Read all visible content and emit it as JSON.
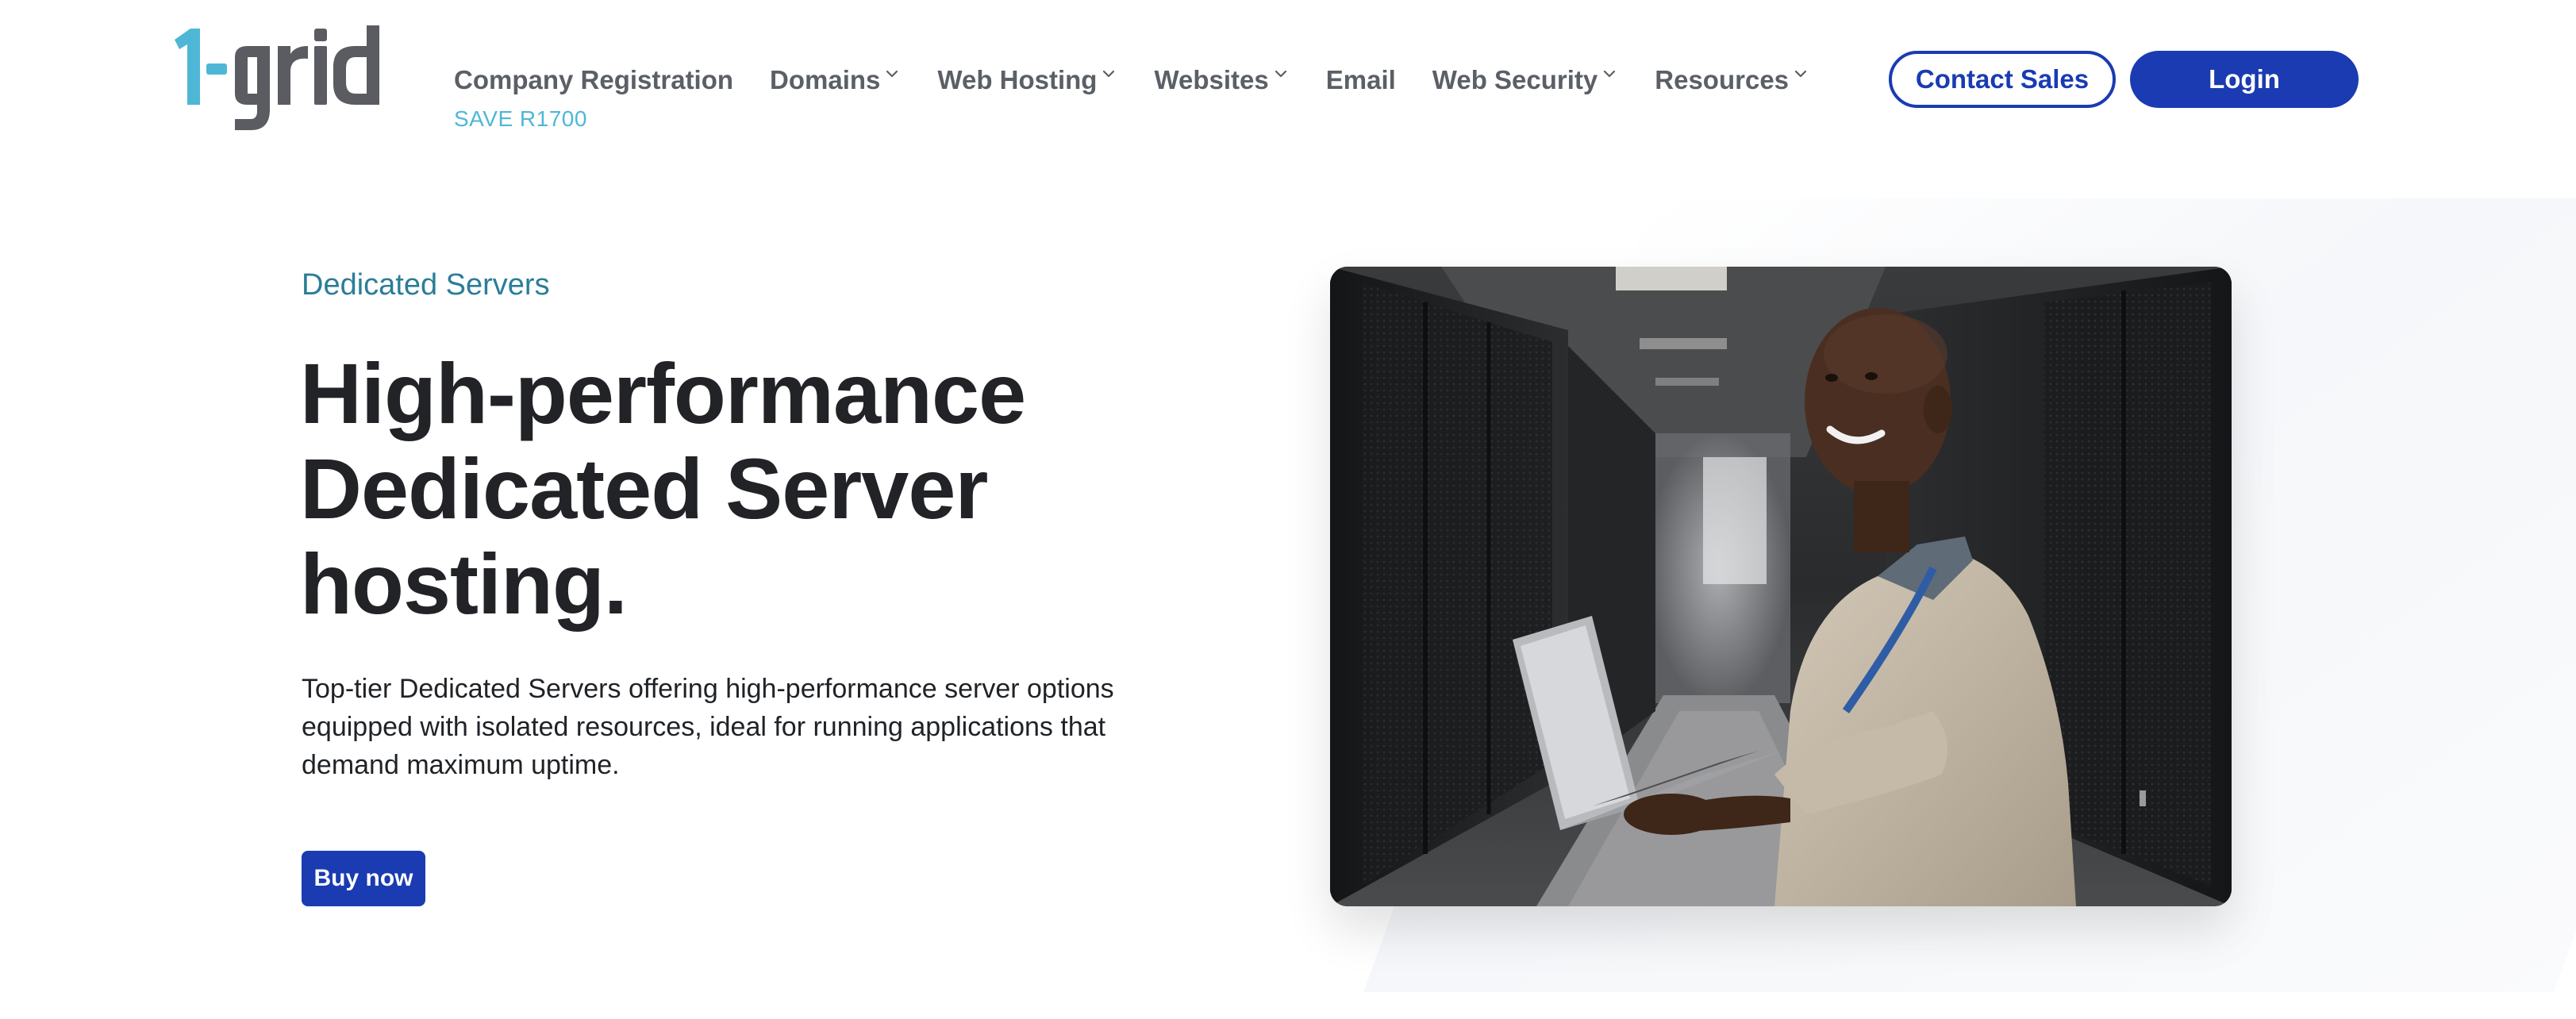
{
  "brand": {
    "logo_text": "1-grid",
    "colors": {
      "logo_accent": "#4fb7d6",
      "logo_dark": "#5a5c61",
      "primary": "#1a3bb2",
      "eyebrow": "#2b7d99",
      "nav_text": "#5b5f66",
      "promo": "#4fb7d6"
    }
  },
  "nav": {
    "items": [
      {
        "label": "Company Registration",
        "has_dropdown": false,
        "badge": "SAVE R1700"
      },
      {
        "label": "Domains",
        "has_dropdown": true
      },
      {
        "label": "Web Hosting",
        "has_dropdown": true
      },
      {
        "label": "Websites",
        "has_dropdown": true
      },
      {
        "label": "Email",
        "has_dropdown": false
      },
      {
        "label": "Web Security",
        "has_dropdown": true
      },
      {
        "label": "Resources",
        "has_dropdown": true
      }
    ],
    "contact_sales_label": "Contact Sales",
    "login_label": "Login"
  },
  "hero": {
    "eyebrow": "Dedicated Servers",
    "title_lines": [
      "High-performance",
      "Dedicated Server",
      "hosting."
    ],
    "description": "Top-tier Dedicated Servers offering high-performance server options equipped with isolated resources, ideal for running applications that demand maximum uptime.",
    "cta_label": "Buy now",
    "image_icon": "photo-technician-with-laptop-in-server-room"
  }
}
